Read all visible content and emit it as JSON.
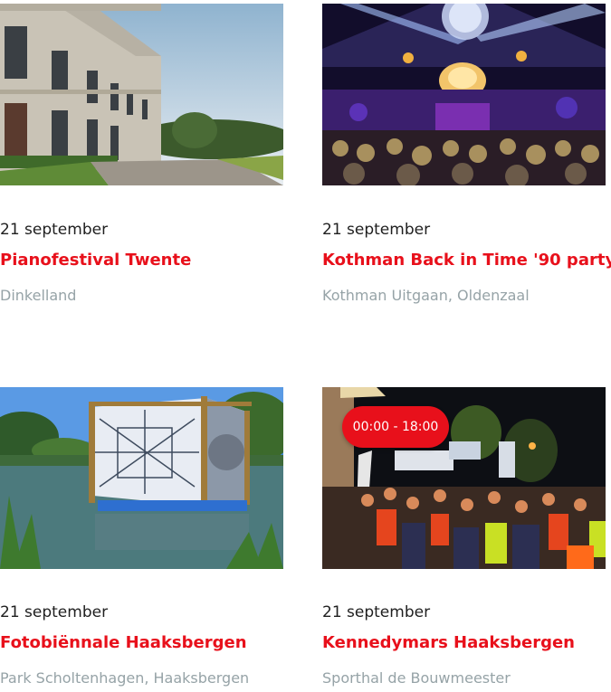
{
  "events": [
    {
      "date": "21 september",
      "title": "Pianofestival Twente",
      "location": "Dinkelland",
      "image": "manor-house-photo"
    },
    {
      "date": "21 september",
      "title": "Kothman Back in Time '90 party",
      "location": "Kothman Uitgaan, Oldenzaal",
      "image": "party-hall-photo"
    },
    {
      "date": "21 september",
      "title": "Fotobiënnale Haaksbergen",
      "location": "Park Scholtenhagen, Haaksbergen",
      "image": "pond-installation-photo"
    },
    {
      "date": "21 september",
      "title": "Kennedymars Haaksbergen",
      "location": "Sporthal de Bouwmeester",
      "image": "night-march-photo",
      "time_badge": "00:00 - 18:00"
    }
  ],
  "colors": {
    "accent": "#e8101b",
    "muted": "#96a3a7",
    "text": "#1f1f1f"
  }
}
